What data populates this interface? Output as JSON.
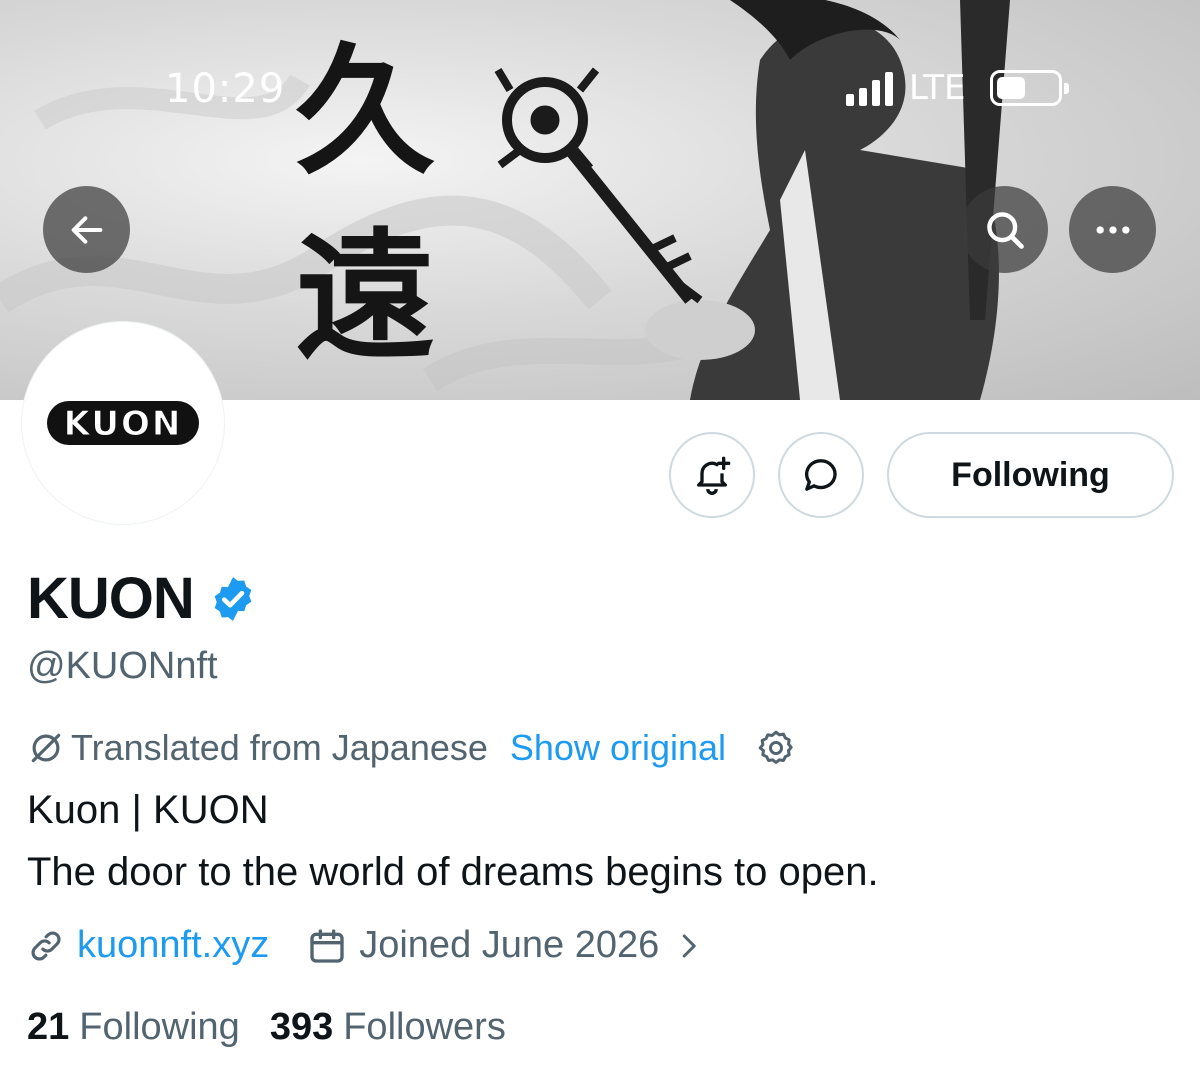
{
  "status_bar": {
    "time": "10:29",
    "network": "LTE"
  },
  "banner": {
    "calligraphy": [
      "久",
      "遠"
    ]
  },
  "header_actions": {
    "back_icon": "arrow-left-icon",
    "search_icon": "search-icon",
    "more_icon": "more-horizontal-icon"
  },
  "avatar": {
    "logo_text": "KUON"
  },
  "actions": {
    "notify_icon": "bell-plus-icon",
    "message_icon": "message-bubble-icon",
    "following_label": "Following"
  },
  "profile": {
    "display_name": "KUON",
    "verified": true,
    "handle": "@KUONnft",
    "translation": {
      "label": "Translated from Japanese",
      "show_original": "Show original"
    },
    "bio": [
      "Kuon | KUON",
      "The door to the world of dreams begins to open."
    ],
    "website": "kuonnft.xyz",
    "joined": "Joined June 2026"
  },
  "stats": {
    "following_count": "21",
    "following_label": "Following",
    "followers_count": "393",
    "followers_label": "Followers"
  },
  "colors": {
    "accent": "#1d9bf0",
    "muted": "#536471",
    "text": "#0f1419",
    "border": "#cfd9de"
  }
}
